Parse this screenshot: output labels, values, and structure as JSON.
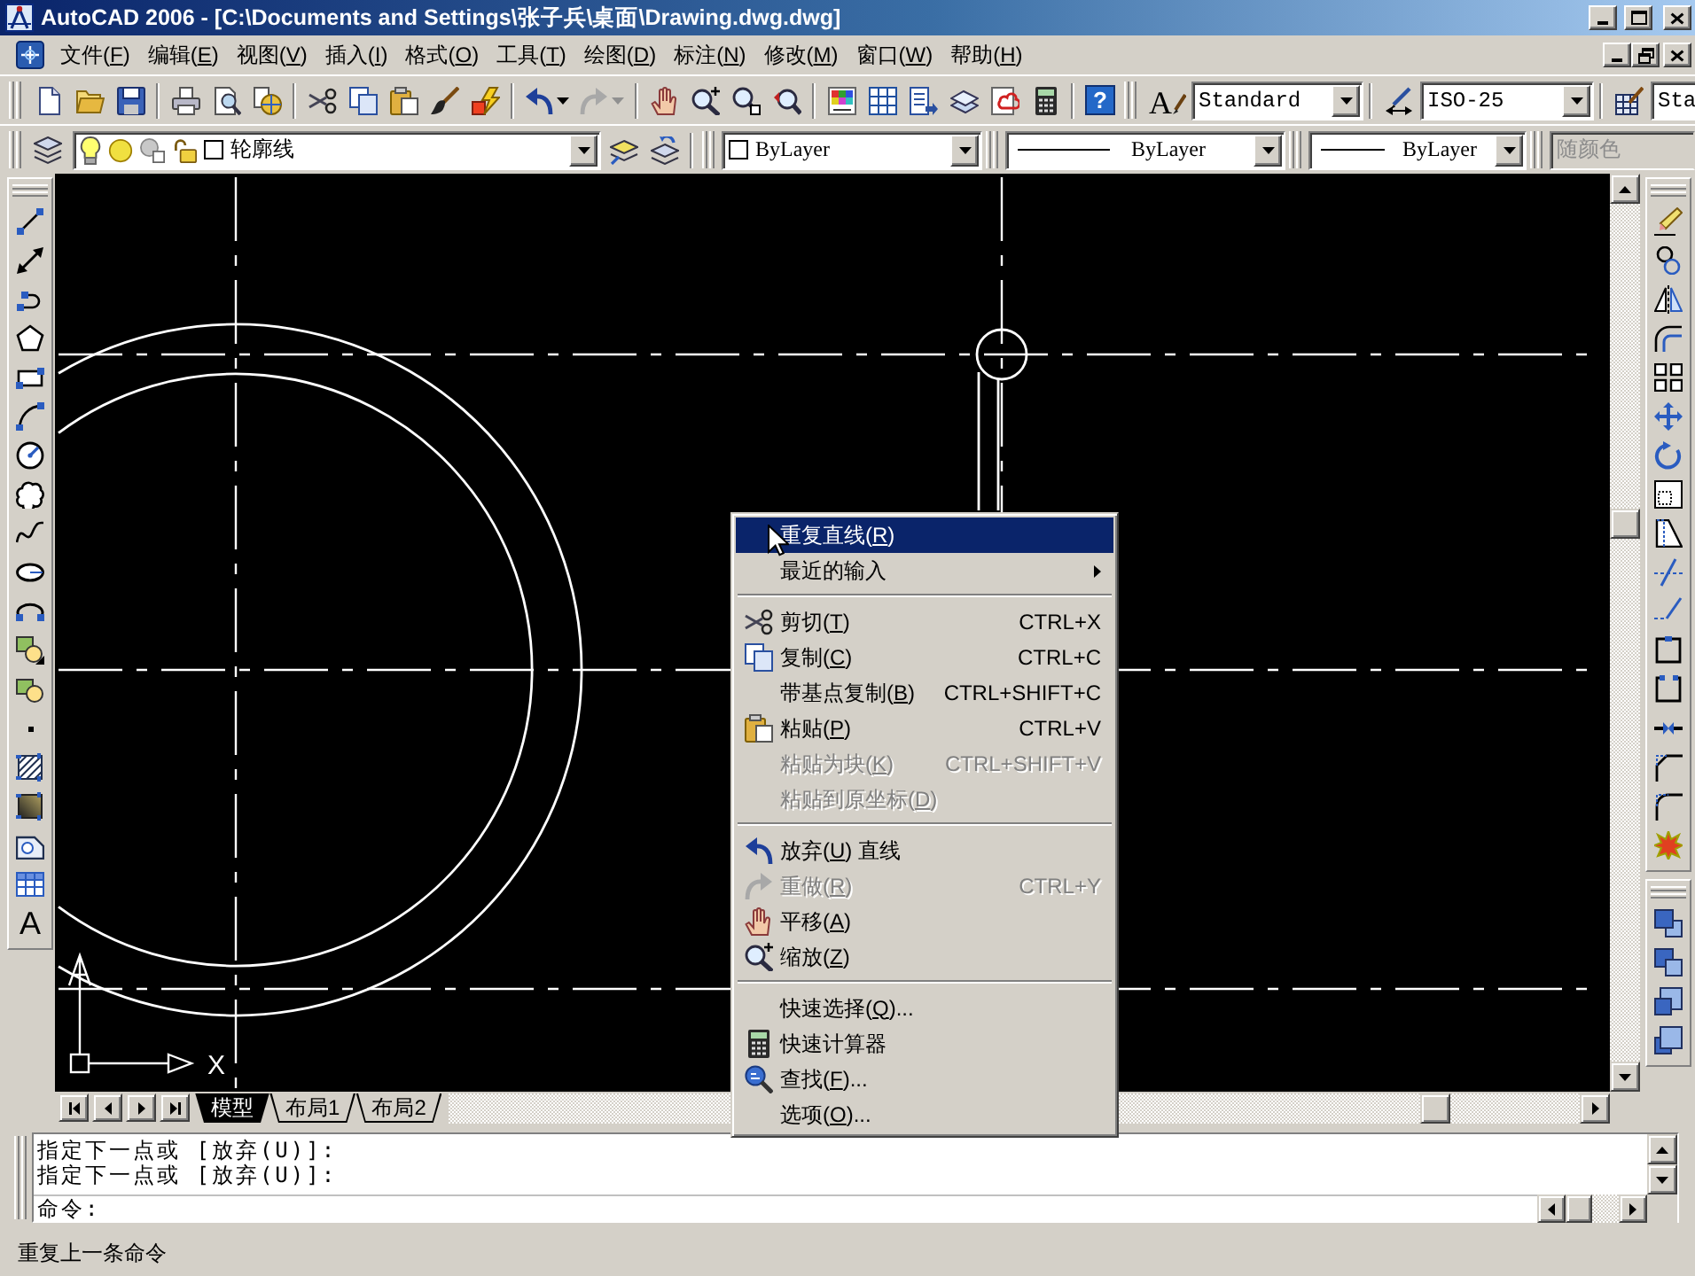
{
  "window": {
    "title": "AutoCAD 2006 - [C:\\Documents and Settings\\张子兵\\桌面\\Drawing.dwg.dwg]"
  },
  "menu_bar": {
    "items": [
      "文件(F)",
      "编辑(E)",
      "视图(V)",
      "插入(I)",
      "格式(O)",
      "工具(T)",
      "绘图(D)",
      "标注(N)",
      "修改(M)",
      "窗口(W)",
      "帮助(H)"
    ]
  },
  "standard_toolbar": {
    "redo": {
      "disabled": true
    },
    "help_glyph": "?"
  },
  "styles_toolbar": {
    "text_style_glyph": "A",
    "text_style": "Standard",
    "dimension_style": "ISO-25",
    "table_style": "Sta"
  },
  "layers_toolbar": {
    "layer": {
      "name": "轮廓线",
      "on": true,
      "frozen": false,
      "locked": false
    }
  },
  "properties_toolbar": {
    "color_setting": "ByLayer",
    "linetype": "ByLayer",
    "lineweight": "ByLayer",
    "plot_style": {
      "value": "随颜色",
      "disabled": true
    }
  },
  "draw_toolbar": {
    "text_glyph": "A"
  },
  "drawing": {
    "ucs_x_label": "X"
  },
  "layout_tabs": [
    {
      "label": "模型",
      "selected": true
    },
    {
      "label": "布局1",
      "selected": false
    },
    {
      "label": "布局2",
      "selected": false
    }
  ],
  "context_menu": {
    "sections": [
      {
        "items": [
          {
            "label": "重复直线(R)",
            "selected": true,
            "disabled": false,
            "submenu": false
          },
          {
            "label": "最近的输入",
            "selected": false,
            "disabled": false,
            "submenu": true
          }
        ]
      },
      {
        "items": [
          {
            "label": "剪切(T)",
            "shortcut": "CTRL+X",
            "selected": false,
            "disabled": false,
            "submenu": false
          },
          {
            "label": "复制(C)",
            "shortcut": "CTRL+C",
            "selected": false,
            "disabled": false,
            "submenu": false
          },
          {
            "label": "带基点复制(B)",
            "shortcut": "CTRL+SHIFT+C",
            "selected": false,
            "disabled": false,
            "submenu": false
          },
          {
            "label": "粘贴(P)",
            "shortcut": "CTRL+V",
            "selected": false,
            "disabled": false,
            "submenu": false
          },
          {
            "label": "粘贴为块(K)",
            "shortcut": "CTRL+SHIFT+V",
            "selected": false,
            "disabled": true,
            "submenu": false
          },
          {
            "label": "粘贴到原坐标(D)",
            "selected": false,
            "disabled": true,
            "submenu": false
          }
        ]
      },
      {
        "items": [
          {
            "label": "放弃(U) 直线",
            "selected": false,
            "disabled": false,
            "submenu": false
          },
          {
            "label": "重做(R)",
            "shortcut": "CTRL+Y",
            "selected": false,
            "disabled": true,
            "submenu": false
          },
          {
            "label": "平移(A)",
            "selected": false,
            "disabled": false,
            "submenu": false
          },
          {
            "label": "缩放(Z)",
            "selected": false,
            "disabled": false,
            "submenu": false
          }
        ]
      },
      {
        "items": [
          {
            "label": "快速选择(Q)...",
            "selected": false,
            "disabled": false,
            "submenu": false
          },
          {
            "label": "快速计算器",
            "selected": false,
            "disabled": false,
            "submenu": false
          },
          {
            "label": "查找(F)...",
            "selected": false,
            "disabled": false,
            "submenu": false
          },
          {
            "label": "选项(O)...",
            "selected": false,
            "disabled": false,
            "submenu": false
          }
        ]
      }
    ]
  },
  "command_window": {
    "history": [
      "指定下一点或 [放弃(U)]:",
      "指定下一点或 [放弃(U)]:"
    ],
    "prompt": "命令:"
  },
  "status_bar": {
    "text": "重复上一条命令"
  }
}
